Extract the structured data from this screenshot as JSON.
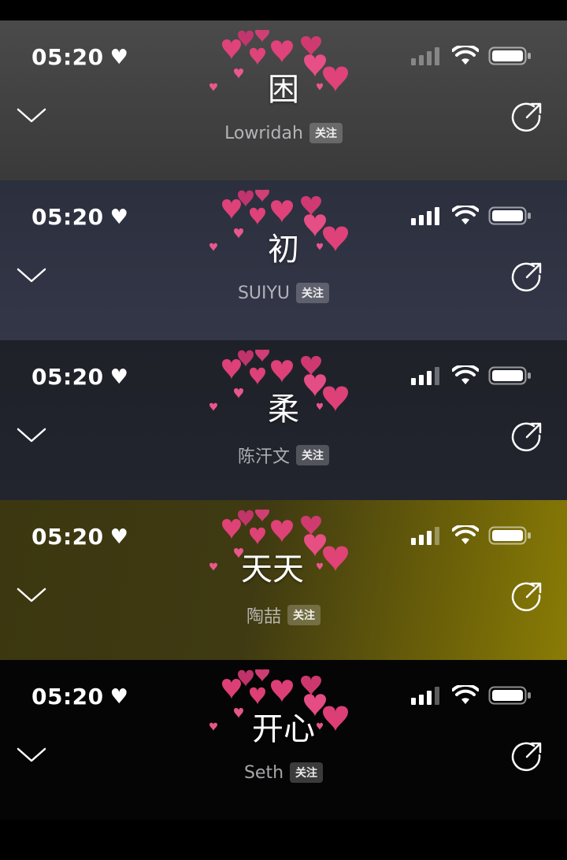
{
  "panels": [
    {
      "time": "05:20",
      "title": "困",
      "artist": "Lowridah",
      "follow": "关注",
      "bg": "linear-gradient(180deg,#4a4a4a 0%,#3a3a3a 100%)",
      "signal_bars_active": 0,
      "title_dx": 0
    },
    {
      "time": "05:20",
      "title": "初",
      "artist": "SUIYU",
      "follow": "关注",
      "bg": "linear-gradient(180deg,#2c2f3d 0%,#333748 100%)",
      "signal_bars_active": 4,
      "title_dx": 0
    },
    {
      "time": "05:20",
      "title": "柔",
      "artist": "陈汗文",
      "follow": "关注",
      "bg": "linear-gradient(180deg,#1f2129 0%,#22252e 100%)",
      "signal_bars_active": 3,
      "title_dx": 0
    },
    {
      "time": "05:20",
      "title": "天天",
      "artist": "陶喆",
      "follow": "关注",
      "bg": "linear-gradient(100deg,#3c3710 0%,#3f3a12 45%,#6e6308 80%,#8a7c06 100%)",
      "signal_bars_active": 3,
      "title_dx": -14
    },
    {
      "time": "05:20",
      "title": "开心",
      "artist": "Seth",
      "follow": "关注",
      "bg": "#050505",
      "signal_bars_active": 3,
      "title_dx": 0
    }
  ],
  "icons": {
    "heart": "♥",
    "chevron": "chevron-down-icon",
    "share": "share-icon",
    "signal": "signal-icon",
    "wifi": "wifi-icon",
    "battery": "battery-icon"
  },
  "colors": {
    "heart_pink": "#e23c78",
    "heart_light": "#f06ea0"
  }
}
